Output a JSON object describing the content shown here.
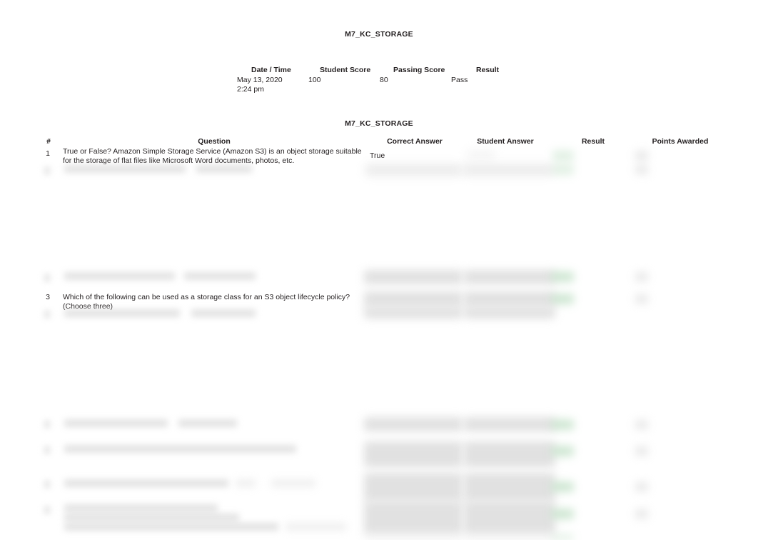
{
  "document": {
    "quiz_title": "M7_KC_STORAGE",
    "table_title": "M7_KC_STORAGE"
  },
  "summary": {
    "headers": {
      "date_time": "Date / Time",
      "student_score": "Student Score",
      "passing_score": "Passing Score",
      "result": "Result"
    },
    "values": {
      "date": "May 13, 2020",
      "time": "2:24 pm",
      "student_score": "100",
      "passing_score": "80",
      "result": "Pass"
    }
  },
  "table": {
    "headers": {
      "number": "#",
      "question": "Question",
      "correct_answer": "Correct Answer",
      "student_answer": "Student Answer",
      "result": "Result",
      "points_awarded": "Points Awarded"
    },
    "rows": [
      {
        "number": "1",
        "question": "True or False? Amazon Simple Storage Service (Amazon S3) is an object storage suitable for the storage of flat files like Microsoft Word documents, photos, etc.",
        "correct_answer": "True",
        "student_answer": "",
        "result": "",
        "points_awarded": "",
        "redacted": false
      },
      {
        "number": "3",
        "question": "Which of the following can be used as a storage class for an S3 object lifecycle policy? (Choose three)",
        "correct_answer": "",
        "student_answer": "",
        "result": "",
        "points_awarded": "",
        "redacted": false
      }
    ]
  }
}
